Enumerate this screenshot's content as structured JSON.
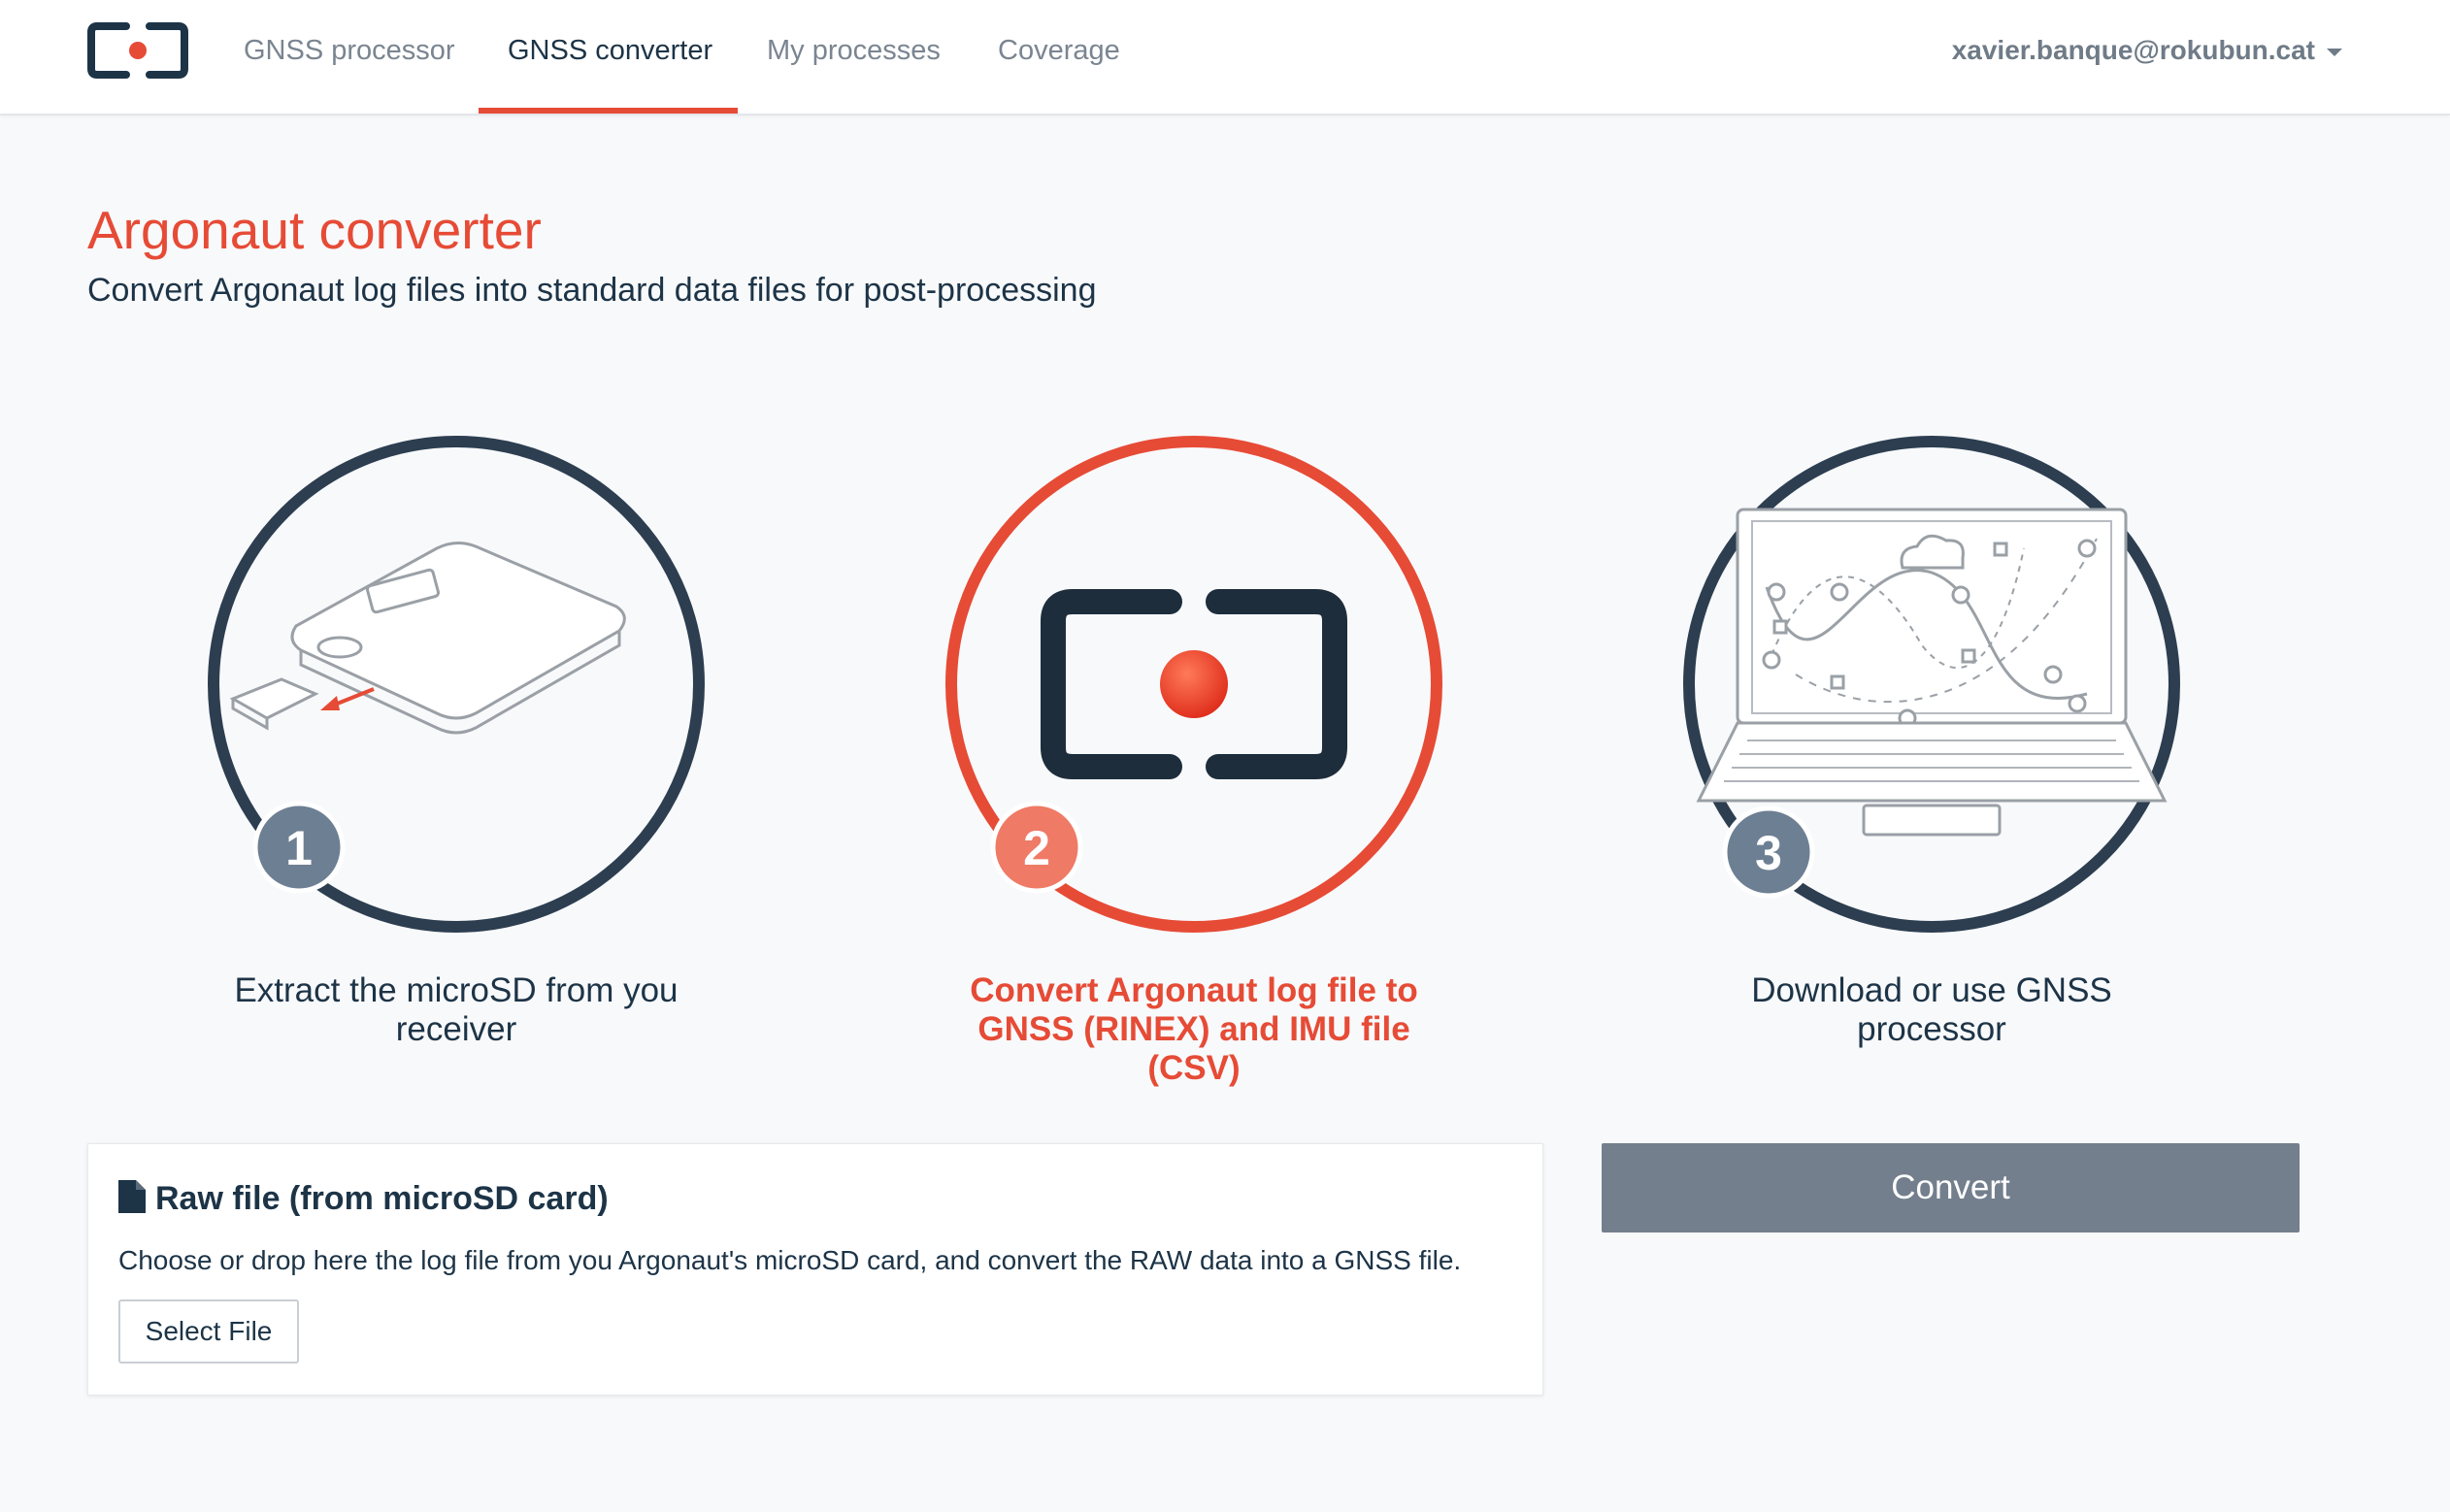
{
  "colors": {
    "accent": "#e64b36",
    "dark": "#1d3447",
    "muted": "#737f8d"
  },
  "nav": {
    "items": [
      {
        "label": "GNSS processor"
      },
      {
        "label": "GNSS converter"
      },
      {
        "label": "My processes"
      },
      {
        "label": "Coverage"
      }
    ],
    "active_item": "GNSS converter",
    "user": "xavier.banque@rokubun.cat"
  },
  "header": {
    "title": "Argonaut converter",
    "subtitle": "Convert Argonaut log files into standard data files for post-processing"
  },
  "steps": [
    {
      "number": "1",
      "label": "Extract the microSD from you receiver",
      "icon": "receiver-sd-card-icon",
      "active": false
    },
    {
      "number": "2",
      "label": "Convert Argonaut log file to GNSS (RINEX) and IMU file (CSV)",
      "icon": "rokubun-logo-icon",
      "active": true
    },
    {
      "number": "3",
      "label": "Download or use GNSS processor",
      "icon": "laptop-map-icon",
      "active": false
    }
  ],
  "upload": {
    "icon": "file-icon",
    "title": "Raw file (from microSD card)",
    "description": "Choose or drop here the log file from you Argonaut's microSD card, and convert the RAW data into a GNSS file.",
    "select_label": "Select File"
  },
  "convert_label": "Convert"
}
